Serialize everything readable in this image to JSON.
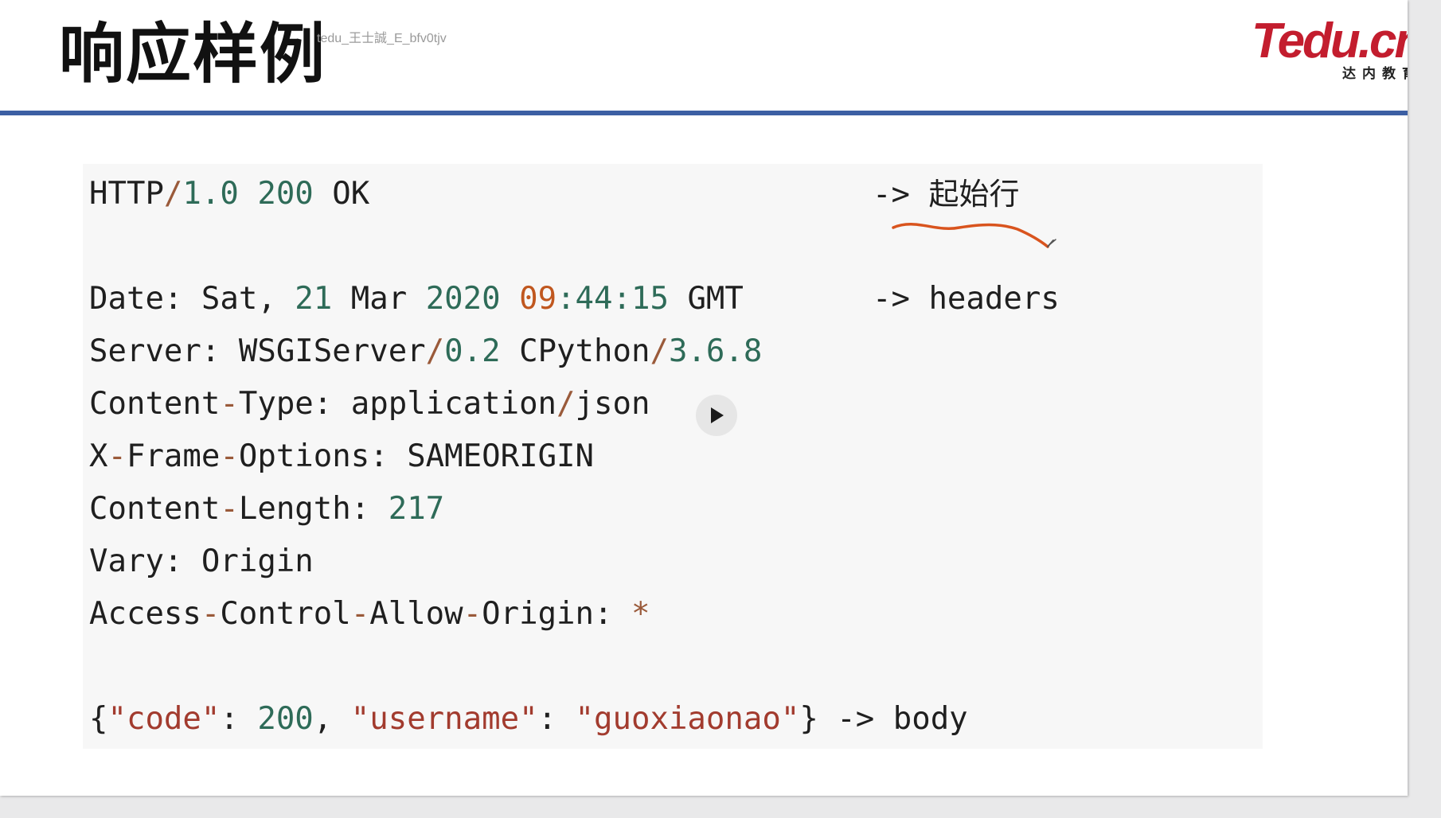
{
  "slide": {
    "title": "响应样例",
    "watermark": "tedu_王士誠_E_bfv0tjv",
    "logo": {
      "text": "Tedu.cn",
      "subtitle": "达内教育"
    },
    "accent_color": "#3c5fa3",
    "annotation_color": "#d9541e"
  },
  "code": {
    "status": {
      "proto": "HTTP",
      "slash": "/",
      "version": "1.0",
      "code": "200",
      "reason": "OK",
      "arrow": "->",
      "label": "起始行"
    },
    "date": {
      "key": "Date",
      "colon": ":",
      "v1": "Sat,",
      "v2": "21",
      "v3": "Mar",
      "v4": "2020",
      "v5": "09",
      "v6": ":44:15",
      "v7": "GMT",
      "arrow": "->",
      "label": "headers"
    },
    "server": {
      "key": "Server",
      "colon": ":",
      "v1": "WSGIServer",
      "slash1": "/",
      "v2": "0.2",
      "v3": "CPython",
      "slash2": "/",
      "v4": "3.6.8"
    },
    "ctype": {
      "k1": "Content",
      "dash": "-",
      "k2": "Type",
      "colon": ":",
      "v1": "application",
      "slash": "/",
      "v2": "json"
    },
    "xframe": {
      "k1": "X",
      "d1": "-",
      "k2": "Frame",
      "d2": "-",
      "k3": "Options",
      "colon": ":",
      "v": "SAMEORIGIN"
    },
    "clen": {
      "k1": "Content",
      "dash": "-",
      "k2": "Length",
      "colon": ":",
      "v": "217"
    },
    "vary": {
      "key": "Vary",
      "colon": ":",
      "v": "Origin"
    },
    "acao": {
      "k1": "Access",
      "d1": "-",
      "k2": "Control",
      "d2": "-",
      "k3": "Allow",
      "d3": "-",
      "k4": "Origin",
      "colon": ":",
      "v": "*"
    },
    "body": {
      "open": "{",
      "k1": "\"code\"",
      "c1": ":",
      "v1": "200",
      "comma": ",",
      "k2": "\"username\"",
      "c2": ":",
      "v2": "\"guoxiaonao\"",
      "close": "}",
      "arrow": "->",
      "label": "body"
    }
  }
}
